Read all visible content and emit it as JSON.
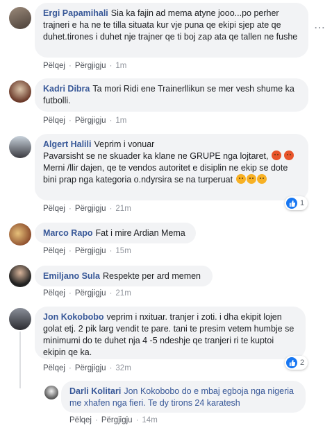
{
  "actions": {
    "like": "Pëlqej",
    "reply": "Përgjigju"
  },
  "comments": [
    {
      "name": "Ergi Papamihali",
      "text": "Sia ka fajin ad mema atyne jooo...po perher trajneri e ha ne te tilla situata kur vje puna qe ekipi sjep ate qe duhet.tirones i duhet nje trajner qe ti boj zap ata qe tallen ne fushe",
      "time": "1m"
    },
    {
      "name": "Kadri Dibra",
      "text": "Ta mori Ridi ene Trainerllikun se mer vesh shume ka futbolli.",
      "time": "1m"
    },
    {
      "name": "Algert Halili",
      "text": "Veprim i vonuar",
      "line2": "Pavarsisht se ne skuader ka klane ne GRUPE nga lojtaret,",
      "line3": "Merni /llir dajen, qe te vendos autoritet e disiplin ne ekip se dote bini prap nga kategoria o.ndyrsira se na turperuat",
      "time": "21m",
      "reactions": "1"
    },
    {
      "name": "Marco Rapo",
      "text": "Fat i mire Ardian Mema",
      "time": "15m"
    },
    {
      "name": "Emiljano Sula",
      "text": "Respekte per ard memen",
      "time": "21m"
    },
    {
      "name": "Jon Kokobobo",
      "text": "veprim i nxituar. tranjer i zoti. i dha ekipit lojen golat etj. 2 pik larg vendit te pare. tani te presim vetem humbje se minimumi do te duhet nja 4 -5 ndeshje qe tranjeri ri te kuptoi ekipin qe ka.",
      "time": "32m",
      "reactions": "2"
    },
    {
      "name": "Darli Kolitari",
      "text": "Jon Kokobobo do e mbaj egboja nga nigeria me xhafen nga fieri. Te dy tirons 24 karatesh",
      "time": "14m"
    }
  ]
}
